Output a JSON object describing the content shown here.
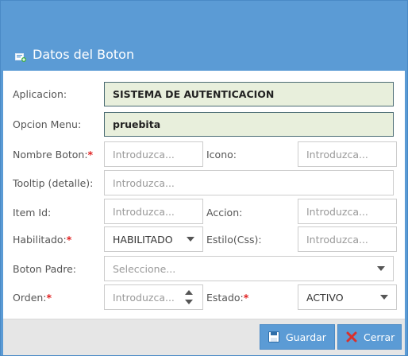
{
  "dialog": {
    "title": "Datos del Boton"
  },
  "form": {
    "aplicacion": {
      "label": "Aplicacion:",
      "value": "SISTEMA DE AUTENTICACION"
    },
    "opcion_menu": {
      "label": "Opcion Menu:",
      "value": "pruebita"
    },
    "nombre_boton": {
      "label": "Nombre Boton:",
      "required_mark": "*",
      "placeholder": "Introduzca..."
    },
    "icono": {
      "label": "Icono:",
      "placeholder": "Introduzca..."
    },
    "tooltip": {
      "label": "Tooltip (detalle):",
      "placeholder": "Introduzca..."
    },
    "item_id": {
      "label": "Item Id:",
      "placeholder": "Introduzca..."
    },
    "accion": {
      "label": "Accion:",
      "placeholder": "Introduzca..."
    },
    "habilitado": {
      "label": "Habilitado:",
      "required_mark": "*",
      "value": "HABILITADO"
    },
    "estilo": {
      "label": "Estilo(Css):",
      "placeholder": "Introduzca..."
    },
    "boton_padre": {
      "label": "Boton Padre:",
      "placeholder": "Seleccione..."
    },
    "orden": {
      "label": "Orden:",
      "required_mark": "*",
      "placeholder": "Introduzca..."
    },
    "estado": {
      "label": "Estado:",
      "required_mark": "*",
      "value": "ACTIVO"
    }
  },
  "footer": {
    "save_label": "Guardar",
    "close_label": "Cerrar"
  },
  "icons": {
    "title": "form-add-icon",
    "save": "floppy-disk-icon",
    "close": "close-x-icon"
  },
  "colors": {
    "header": "#5b9bd5",
    "filled_bg": "#e8efdc",
    "required": "#e02020",
    "close_x": "#d9302c"
  }
}
